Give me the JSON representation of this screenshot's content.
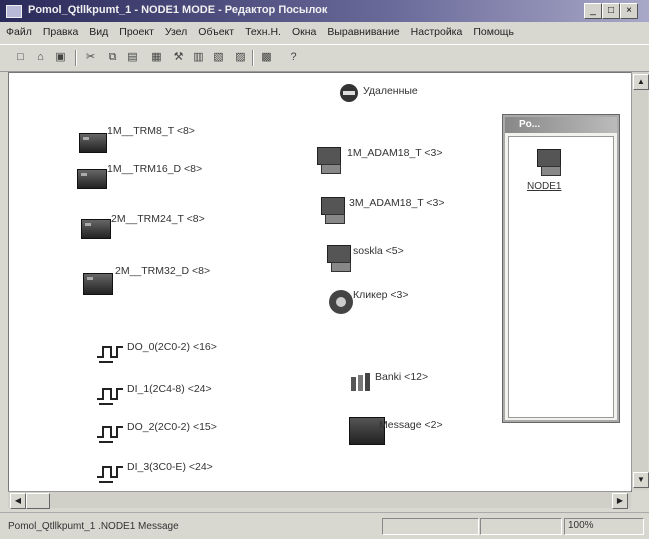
{
  "window": {
    "title": "Pomol_Qtllkpumt_1 - NODE1 MODE - Редактор Посылок"
  },
  "menu": [
    "Файл",
    "Правка",
    "Вид",
    "Проект",
    "Узел",
    "Объект",
    "Техн.Н.",
    "Окна",
    "Выравнивание",
    "Настройка",
    "Помощь"
  ],
  "toolbar_icons": [
    "new-icon",
    "open-icon",
    "save-icon",
    "cut-icon",
    "copy-icon",
    "paste-icon",
    "print-icon",
    "tool-icon",
    "grid-icon",
    "align-icon",
    "view-icon",
    "zoom-icon",
    "help-icon"
  ],
  "canvas": {
    "nodes": {
      "remote": "Удаленные",
      "trm8": "1M__TRM8_T <8>",
      "trm16": "1M__TRM16_D <8>",
      "trm24": "2M__TRM24_T <8>",
      "trm32": "2M__TRM32_D <8>",
      "adam1": "1M_ADAM18_T <3>",
      "adam3": "3M_ADAM18_T <3>",
      "soskla": "soskla <5>",
      "klinker": "Кликер <3>",
      "do0": "DO_0(2C0-2) <16>",
      "di1": "DI_1(2C4-8) <24>",
      "do2": "DO_2(2C0-2) <15>",
      "di3": "DI_3(3C0-E) <24>",
      "banki": "Banki <12>",
      "message": "Message <2>"
    }
  },
  "subwindow": {
    "title": "Po...",
    "node_label": "NODE1"
  },
  "status": {
    "path": "Pomol_Qtllkpumt_1 .NODE1 Message",
    "zoom": "100%"
  },
  "colors": {
    "title_start": "#2a2a5a",
    "title_end": "#a8a8c8",
    "canvas_bg": "#ffffff"
  }
}
